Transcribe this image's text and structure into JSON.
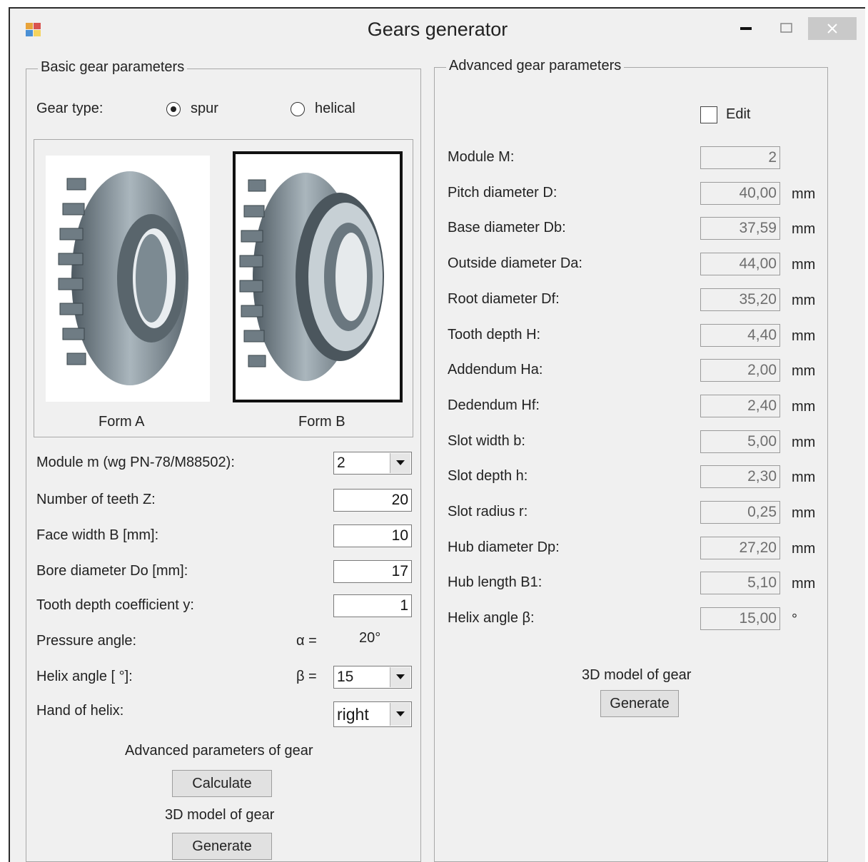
{
  "window": {
    "title": "Gears generator",
    "minimize": "‒",
    "maximize": "☐",
    "close": "✕"
  },
  "basic": {
    "group_label": "Basic gear parameters",
    "gear_type_label": "Gear type:",
    "gear_type_options": [
      "spur",
      "helical"
    ],
    "gear_type_selected": "spur",
    "form_a_label": "Form A",
    "form_b_label": "Form B",
    "module_label": "Module m (wg PN-78/M88502):",
    "module_value": "2",
    "teeth_label": "Number of teeth Z:",
    "teeth_value": "20",
    "face_width_label": "Face width B [mm]:",
    "face_width_value": "10",
    "bore_label": "Bore diameter Do [mm]:",
    "bore_value": "17",
    "tooth_coef_label": "Tooth depth coefficient y:",
    "tooth_coef_value": "1",
    "pressure_label": "Pressure angle:",
    "alpha_symbol": "α =",
    "pressure_value": "20°",
    "helix_label": "Helix angle [ °]:",
    "beta_symbol": "β =",
    "helix_value": "15",
    "hand_label": "Hand of helix:",
    "hand_value": "right",
    "advanced_caption": "Advanced parameters of gear",
    "calculate_button": "Calculate",
    "model_caption": "3D model of gear",
    "generate_button": "Generate"
  },
  "advanced": {
    "group_label": "Advanced gear parameters",
    "edit_label": "Edit",
    "edit_checked": false,
    "rows": [
      {
        "label": "Module M:",
        "value": "2",
        "unit": ""
      },
      {
        "label": "Pitch diameter D:",
        "value": "40,00",
        "unit": "mm"
      },
      {
        "label": "Base diameter Db:",
        "value": "37,59",
        "unit": "mm"
      },
      {
        "label": "Outside diameter Da:",
        "value": "44,00",
        "unit": "mm"
      },
      {
        "label": "Root diameter Df:",
        "value": "35,20",
        "unit": "mm"
      },
      {
        "label": "Tooth depth H:",
        "value": "4,40",
        "unit": "mm"
      },
      {
        "label": "Addendum Ha:",
        "value": "2,00",
        "unit": "mm"
      },
      {
        "label": "Dedendum Hf:",
        "value": "2,40",
        "unit": "mm"
      },
      {
        "label": "Slot width b:",
        "value": "5,00",
        "unit": "mm"
      },
      {
        "label": "Slot depth h:",
        "value": "2,30",
        "unit": "mm"
      },
      {
        "label": "Slot radius r:",
        "value": "0,25",
        "unit": "mm"
      },
      {
        "label": "Hub diameter Dp:",
        "value": "27,20",
        "unit": "mm"
      },
      {
        "label": "Hub length B1:",
        "value": "5,10",
        "unit": "mm"
      },
      {
        "label": "Helix angle β:",
        "value": "15,00",
        "unit": "°"
      }
    ],
    "model_caption": "3D model of gear",
    "generate_button": "Generate"
  }
}
